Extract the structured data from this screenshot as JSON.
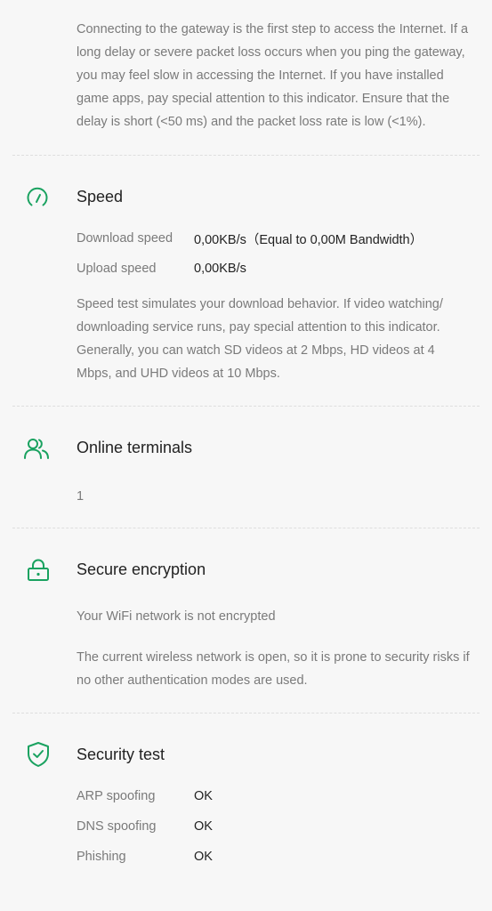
{
  "gateway": {
    "description": "Connecting to the gateway is the first step to access the Internet. If a long delay or severe packet loss occurs when you ping the gateway, you may feel slow in accessing the Internet. If you have installed game apps, pay special attention to this indicator. Ensure that the delay is short (<50 ms) and the packet loss rate is low (<1%)."
  },
  "speed": {
    "title": "Speed",
    "icon": "speedometer-icon",
    "rows": [
      {
        "label": "Download speed",
        "value": "0,00KB/s（Equal to 0,00M Bandwidth）"
      },
      {
        "label": "Upload speed",
        "value": "0,00KB/s"
      }
    ],
    "description": "Speed test simulates your download behavior. If video watching/ downloading service runs, pay special attention to this indicator. Generally, you can watch SD videos at 2 Mbps, HD videos at 4 Mbps, and UHD videos at 10 Mbps."
  },
  "terminals": {
    "title": "Online terminals",
    "icon": "users-icon",
    "count": "1"
  },
  "encryption": {
    "title": "Secure encryption",
    "icon": "lock-icon",
    "status": "Your WiFi network is not encrypted",
    "description": "The current wireless network is open, so it is prone to security risks if no other authentication modes are used."
  },
  "security": {
    "title": "Security test",
    "icon": "shield-check-icon",
    "rows": [
      {
        "label": "ARP spoofing",
        "value": "OK"
      },
      {
        "label": "DNS spoofing",
        "value": "OK"
      },
      {
        "label": "Phishing",
        "value": "OK"
      }
    ]
  },
  "colors": {
    "accent": "#1aa260",
    "text_primary": "#222222",
    "text_secondary": "#7a7a7a",
    "background": "#f7f7f7"
  }
}
